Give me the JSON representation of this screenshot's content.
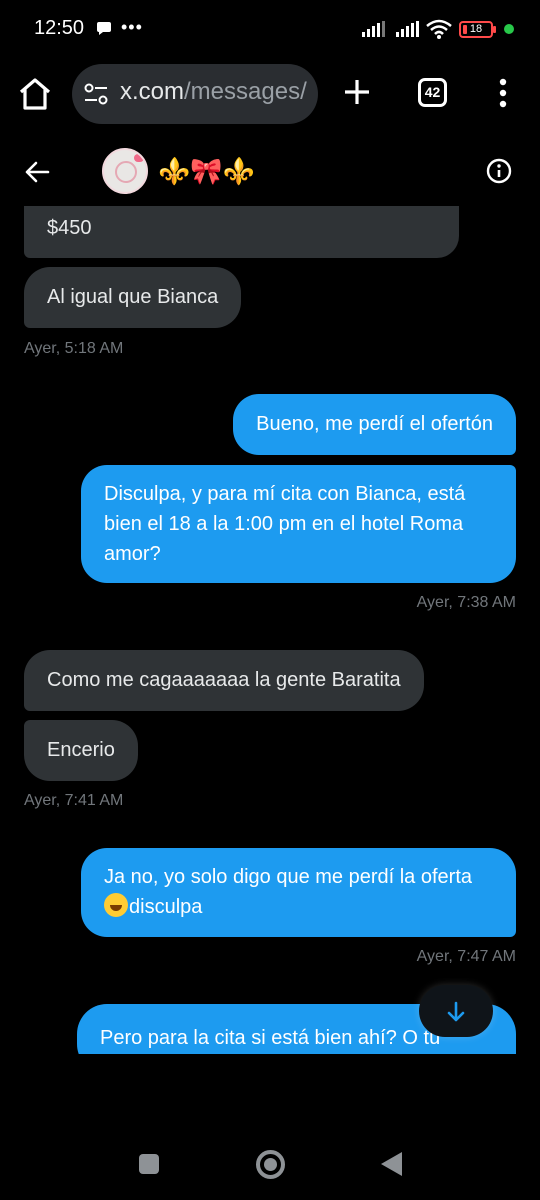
{
  "status_bar": {
    "time": "12:50",
    "dots": "•••",
    "battery": "18",
    "icons": [
      "message-icon",
      "signal-icon",
      "signal-icon",
      "wifi-icon",
      "battery-icon"
    ]
  },
  "browser": {
    "url_host": "x.com",
    "url_path": "/messages/",
    "tab_count": "42"
  },
  "chat": {
    "contact_name": "⚜️🎀⚜️",
    "messages": [
      {
        "direction": "in",
        "text": "$450"
      },
      {
        "direction": "in",
        "text": "Al igual que Bianca"
      },
      {
        "direction": "in",
        "time": "Ayer, 5:18 AM"
      },
      {
        "direction": "out",
        "text": "Bueno, me perdí el ofertón"
      },
      {
        "direction": "out",
        "lines": [
          "Disculpa, y para mí cita con Bianca, está",
          "bien el 18 a la 1:00 pm en el hotel Roma",
          "amor?"
        ]
      },
      {
        "direction": "out",
        "time": "Ayer, 7:38 AM"
      },
      {
        "direction": "in",
        "text": "Como me cagaaaaaaa la gente Baratita"
      },
      {
        "direction": "in",
        "text": "Encerio"
      },
      {
        "direction": "in",
        "time": "Ayer, 7:41 AM"
      },
      {
        "direction": "out",
        "lines": [
          "Ja no, yo solo digo que me perdí la oferta",
          "disculpa"
        ]
      },
      {
        "direction": "out",
        "time": "Ayer, 7:47 AM"
      },
      {
        "direction": "out",
        "text": "Pero para la cita si está bien ahí? O tu"
      }
    ]
  },
  "colors": {
    "background": "#000000",
    "incoming_bubble": "#2f3336",
    "outgoing_bubble": "#1d9bf0",
    "timestamp": "#71767b"
  }
}
